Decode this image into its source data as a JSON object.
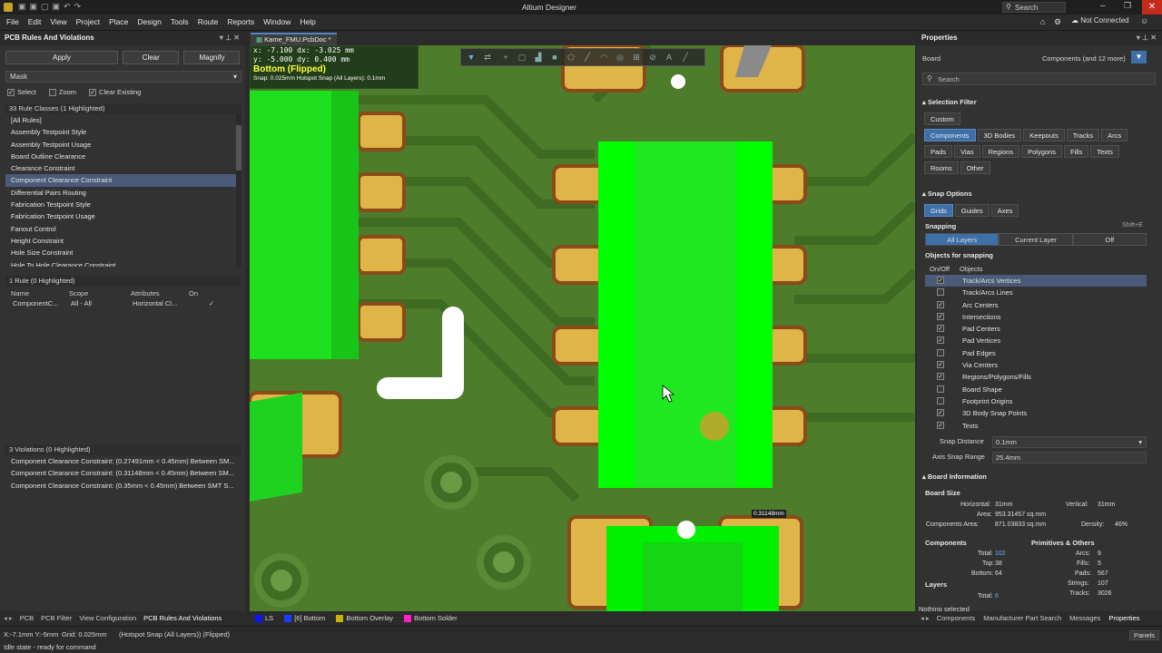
{
  "app": {
    "title": "Altium Designer",
    "search_placeholder": "Search",
    "connection": "Not Connected"
  },
  "menu": [
    "File",
    "Edit",
    "View",
    "Project",
    "Place",
    "Design",
    "Tools",
    "Route",
    "Reports",
    "Window",
    "Help"
  ],
  "left_panel": {
    "title": "PCB Rules And Violations",
    "buttons": {
      "apply": "Apply",
      "clear": "Clear",
      "magnify": "Magnify"
    },
    "mode": "Mask",
    "options": [
      {
        "label": "Select",
        "checked": true
      },
      {
        "label": "Zoom",
        "checked": false
      },
      {
        "label": "Clear Existing",
        "checked": true
      }
    ],
    "rule_classes_header": "33 Rule Classes (1 Highlighted)",
    "rule_classes": [
      "[All Rules]",
      "Assembly Testpoint Style",
      "Assembly Testpoint Usage",
      "Board Outline Clearance",
      "Clearance Constraint",
      "Component Clearance Constraint",
      "Differential Pairs Routing",
      "Fabrication Testpoint Style",
      "Fabrication Testpoint Usage",
      "Fanout Control",
      "Height Constraint",
      "Hole Size Constraint",
      "Hole To Hole Clearance Constraint"
    ],
    "selected_class": "Component Clearance Constraint",
    "rules_header": "1 Rule (0 Highlighted)",
    "rules_columns": [
      "Name",
      "Scope",
      "Attributes",
      "On"
    ],
    "rules": [
      {
        "name": "ComponentC...",
        "scope": "All - All",
        "attributes": "Horizontal Cl...",
        "on": true
      }
    ],
    "violations_header": "3 Violations (0 Highlighted)",
    "violations": [
      "Component Clearance Constraint: (0.27491mm < 0.45mm) Between SM...",
      "Component Clearance Constraint: (0.31148mm < 0.45mm) Between SM...",
      "Component Clearance Constraint: (0.35mm < 0.45mm) Between SMT S..."
    ],
    "bottom_tabs": [
      "PCB",
      "PCB Filter",
      "View Configuration",
      "PCB Rules And Violations"
    ]
  },
  "document": {
    "tab": "Kame_FMU.PcbDoc *",
    "hud": {
      "line1": "x: -7.100   dx: -3.025 mm",
      "line2": "y: -5.000   dy: 0.400 mm",
      "layer": "Bottom (Flipped)",
      "snap": "Snap: 0.025mm Hotspot Snap (All Layers): 0.1mm"
    },
    "measure": "0.31148mm",
    "layer_tabs": [
      {
        "label": "LS",
        "color": "#0a14ff"
      },
      {
        "label": "[6] Bottom",
        "color": "#1a3cff"
      },
      {
        "label": "Bottom Overlay",
        "color": "#c8b400"
      },
      {
        "label": "Bottom Solder",
        "color": "#ff20c8"
      }
    ]
  },
  "right_panel": {
    "title": "Properties",
    "kind": "Board",
    "filter_label": "Components (and 12 more)",
    "search_placeholder": "Search",
    "selection_filter": {
      "title": "Selection Filter",
      "custom": "Custom",
      "items": [
        "Components",
        "3D Bodies",
        "Keepouts",
        "Tracks",
        "Arcs",
        "Pads",
        "Vias",
        "Regions",
        "Polygons",
        "Fills",
        "Texts",
        "Rooms",
        "Other"
      ]
    },
    "snap_options": {
      "title": "Snap Options",
      "items": [
        "Grids",
        "Guides",
        "Axes"
      ],
      "snapping_label": "Snapping",
      "shortcut": "Shift+E",
      "modes": [
        "All Layers",
        "Current Layer",
        "Off"
      ],
      "objects_label": "Objects for snapping",
      "col_on": "On/Off",
      "col_obj": "Objects",
      "objects": [
        {
          "name": "Track/Arcs Vertices",
          "on": true
        },
        {
          "name": "Track/Arcs Lines",
          "on": false
        },
        {
          "name": "Arc Centers",
          "on": true
        },
        {
          "name": "Intersections",
          "on": true
        },
        {
          "name": "Pad Centers",
          "on": true
        },
        {
          "name": "Pad Vertices",
          "on": true
        },
        {
          "name": "Pad Edges",
          "on": false
        },
        {
          "name": "Via Centers",
          "on": true
        },
        {
          "name": "Regions/Polygons/Fills",
          "on": true
        },
        {
          "name": "Board Shape",
          "on": false
        },
        {
          "name": "Footprint Origins",
          "on": false
        },
        {
          "name": "3D Body Snap Points",
          "on": true
        },
        {
          "name": "Texts",
          "on": true
        }
      ],
      "snap_distance_label": "Snap Distance",
      "snap_distance": "0.1mm",
      "axis_range_label": "Axis Snap Range",
      "axis_range": "25.4mm"
    },
    "board_info": {
      "title": "Board Information",
      "size_label": "Board Size",
      "horizontal_label": "Horizontal:",
      "horizontal": "31mm",
      "vertical_label": "Vertical:",
      "vertical": "31mm",
      "area_label": "Area:",
      "area": "953.31457 sq.mm",
      "comp_area_label": "Components Area:",
      "comp_area": "871.03833 sq.mm",
      "density_label": "Density:",
      "density": "46%",
      "components_label": "Components",
      "total_label": "Total:",
      "total": "102",
      "top_label": "Top:",
      "top": "38",
      "bottom_label": "Bottom:",
      "bottom": "64",
      "prims_label": "Primitives & Others",
      "arcs_label": "Arcs:",
      "arcs": "9",
      "fills_label": "Fills:",
      "fills": "5",
      "pads_label": "Pads:",
      "pads": "567",
      "strings_label": "Strings:",
      "strings": "107",
      "tracks_label": "Tracks:",
      "tracks": "3026",
      "layers_label": "Layers",
      "layers_total_label": "Total:",
      "layers_total": "6"
    },
    "nothing_selected": "Nothing selected",
    "bottom_tabs": [
      "Components",
      "Manufacturer Part Search",
      "Messages",
      "Properties"
    ]
  },
  "status": {
    "coords": "X:-7.1mm Y:-5mm",
    "grid": "Grid: 0.025mm",
    "snap": "(Hotspot Snap (All Layers)) (Flipped)",
    "state": "Idle state - ready for command",
    "panels": "Panels"
  }
}
